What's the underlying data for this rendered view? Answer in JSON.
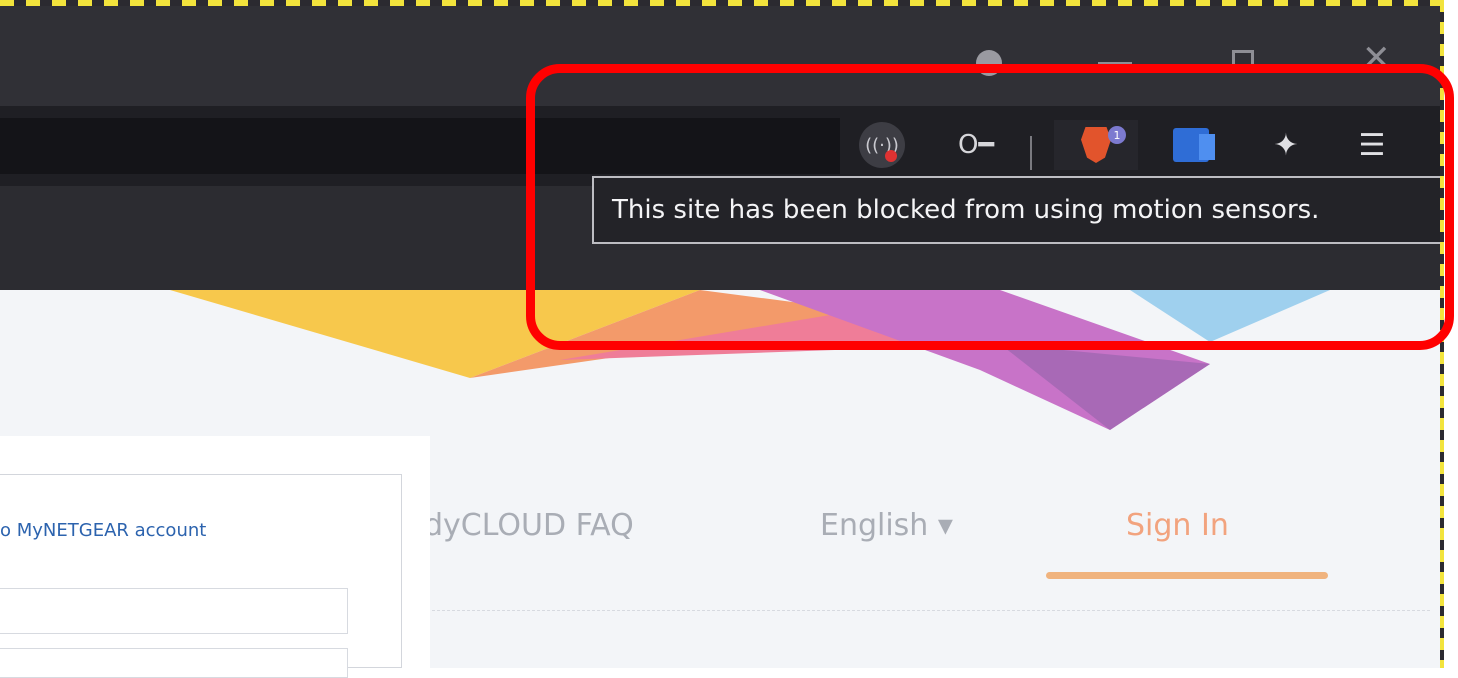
{
  "window": {
    "buttons": [
      "profile",
      "minimize",
      "maximize",
      "close"
    ],
    "close_glyph": "✕"
  },
  "toolbar": {
    "icons": [
      "motion-sensor-blocked-icon",
      "key-icon",
      "brave-shields-icon",
      "translate-extension-icon",
      "extensions-puzzle-icon",
      "menu-icon"
    ],
    "brave_badge": "1"
  },
  "tooltip": {
    "text": "This site has been blocked from using motion sensors."
  },
  "page": {
    "nav": {
      "faq": "dyCLOUD FAQ",
      "language": "English ▾",
      "sign_in": "Sign In"
    },
    "login": {
      "title": "o MyNETGEAR account"
    }
  },
  "colors": {
    "highlight": "#ff0000",
    "titlebar": "#303036",
    "toolbar": "#1f1f24",
    "sign_in": "#f2a37e",
    "link": "#2c63ae"
  }
}
